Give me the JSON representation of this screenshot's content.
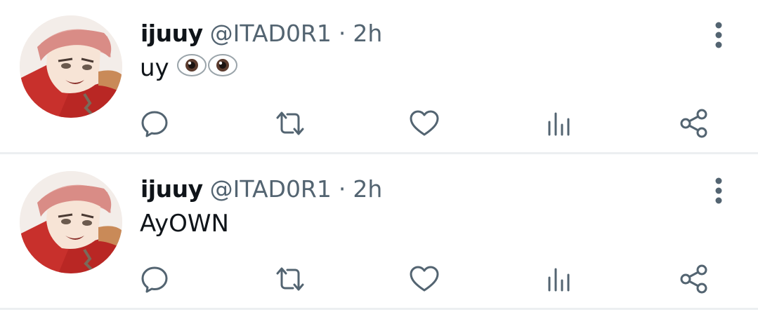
{
  "colors": {
    "text_primary": "#0f1419",
    "text_secondary": "#536471",
    "icon": "#536471",
    "divider": "#eceff1"
  },
  "tweets": [
    {
      "name": "ijuuy",
      "handle": "@ITAD0R1",
      "separator": "·",
      "time": "2h",
      "text": "uy",
      "emoji": "eyes-emoji",
      "avatar": "avatar-anime-character",
      "actions": [
        "reply-icon",
        "retweet-icon",
        "like-icon",
        "views-icon",
        "share-icon"
      ]
    },
    {
      "name": "ijuuy",
      "handle": "@ITAD0R1",
      "separator": "·",
      "time": "2h",
      "text": "AyOWN",
      "avatar": "avatar-anime-character",
      "actions": [
        "reply-icon",
        "retweet-icon",
        "like-icon",
        "views-icon",
        "share-icon"
      ]
    }
  ]
}
